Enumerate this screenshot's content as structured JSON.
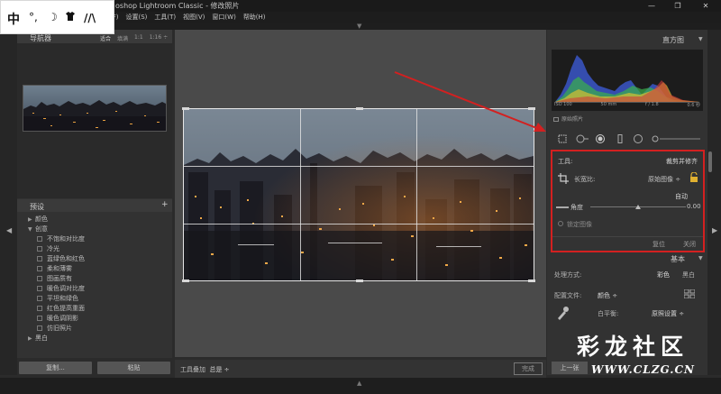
{
  "window": {
    "title": "oshop Lightroom Classic - 修改照片",
    "controls": [
      "—",
      "❐",
      "✕"
    ]
  },
  "menubar": {
    "items": [
      "件(F)",
      "设置(S)",
      "工具(T)",
      "视图(V)",
      "窗口(W)",
      "帮助(H)"
    ]
  },
  "ime": {
    "lang": "中",
    "glyphs": [
      "°,",
      "☽",
      "👕",
      "//\\"
    ]
  },
  "navigator": {
    "title": "导航器",
    "zooms": [
      "适合",
      "填满",
      "1:1",
      "1:16 ÷"
    ]
  },
  "presets": {
    "title": "预设",
    "add": "+",
    "items": [
      {
        "label": "颜色",
        "level": 0,
        "expanded": false
      },
      {
        "label": "创意",
        "level": 0,
        "expanded": true
      },
      {
        "label": "不饱和对比度",
        "level": 1
      },
      {
        "label": "冷光",
        "level": 1
      },
      {
        "label": "蓝绿色和红色",
        "level": 1
      },
      {
        "label": "柔和薄雾",
        "level": 1
      },
      {
        "label": "图画质有",
        "level": 1
      },
      {
        "label": "暖色调对比度",
        "level": 1
      },
      {
        "label": "平坦和绿色",
        "level": 1
      },
      {
        "label": "红色提高重面",
        "level": 1
      },
      {
        "label": "暖色调阴影",
        "level": 1
      },
      {
        "label": "仿旧照片",
        "level": 1
      },
      {
        "label": "黑白",
        "level": 0,
        "expanded": false
      }
    ]
  },
  "left_buttons": {
    "copy": "复制...",
    "paste": "粘贴"
  },
  "toolbar": {
    "label": "工具叠加",
    "value": "总是 ÷",
    "done": "完成"
  },
  "histogram": {
    "title": "直方图",
    "info": [
      "ISO 100",
      "50 mm",
      "f / 1.8",
      "0.6 秒"
    ],
    "original_photo": "原始照片"
  },
  "crop": {
    "tool_label": "工具:",
    "tool_name": "裁剪并修齐",
    "aspect_label": "长宽比:",
    "aspect_value": "原始图像 ÷",
    "auto": "自动",
    "angle_label": "角度",
    "angle_value": "0.00",
    "constrain": "锁定图像",
    "reset": "复位",
    "close": "关闭"
  },
  "basic": {
    "title": "基本",
    "treatment_label": "处理方式:",
    "color": "彩色",
    "bw": "黑白",
    "profile_label": "配置文件:",
    "profile_value": "颜色 ÷",
    "wb_label": "白平衡:",
    "wb_value": "原照设置 ÷"
  },
  "right_buttons": {
    "sync": "上一张"
  },
  "watermark": {
    "cn": "彩龙社区",
    "url": "WWW.CLZG.CN"
  },
  "colors": {
    "highlight_red": "#d32020",
    "panel_bg": "#323232",
    "canvas_bg": "#4a4a4a"
  }
}
